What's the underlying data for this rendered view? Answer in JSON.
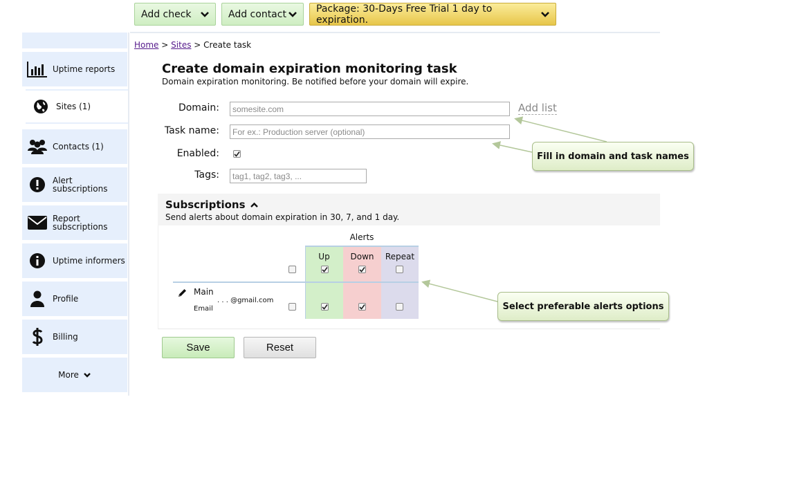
{
  "topbar": {
    "add_check": "Add check",
    "add_contact": "Add contact",
    "package": "Package: 30-Days Free Trial 1 day to expiration."
  },
  "sidebar": {
    "items": [
      {
        "label": "Uptime reports",
        "icon": "bar-chart-icon"
      },
      {
        "label": "Sites (1)",
        "icon": "globe-icon"
      },
      {
        "label": "Contacts (1)",
        "icon": "users-icon"
      },
      {
        "label_line1": "Alert",
        "label_line2": "subscriptions",
        "icon": "exclamation-icon"
      },
      {
        "label_line1": "Report",
        "label_line2": "subscriptions",
        "icon": "envelope-icon"
      },
      {
        "label": "Uptime informers",
        "icon": "info-icon"
      },
      {
        "label": "Profile",
        "icon": "user-icon"
      },
      {
        "label": "Billing",
        "icon": "dollar-icon"
      },
      {
        "label": "More",
        "icon": "chevron-down-icon"
      }
    ]
  },
  "breadcrumb": {
    "home": "Home",
    "sep": ">",
    "sites": "Sites",
    "current": "Create task"
  },
  "page": {
    "title": "Create domain expiration monitoring task",
    "subtitle": "Domain expiration monitoring. Be notified before your domain will expire."
  },
  "form": {
    "domain_label": "Domain:",
    "domain_placeholder": "somesite.com",
    "add_list": "Add list",
    "task_label": "Task name:",
    "task_placeholder": "For ex.: Production server (optional)",
    "enabled_label": "Enabled:",
    "enabled": true,
    "tags_label": "Tags:",
    "tags_placeholder": "tag1, tag2, tag3, ..."
  },
  "subscriptions": {
    "title": "Subscriptions",
    "description": "Send alerts about domain expiration in 30, 7, and 1 day.",
    "alerts_header": "Alerts",
    "columns": [
      "Up",
      "Down",
      "Repeat"
    ],
    "header_checks": {
      "all": false,
      "up": true,
      "down": true,
      "repeat": false
    },
    "row": {
      "name": "Main",
      "type": "Email",
      "address": ". . . @gmail.com",
      "all": false,
      "up": true,
      "down": true,
      "repeat": false
    },
    "colors": {
      "up": "#d3efc9",
      "down": "#f6cfcf",
      "repeat": "#dcdbec"
    }
  },
  "callouts": {
    "names": "Fill in domain and task names",
    "alerts": "Select preferable alerts options"
  },
  "actions": {
    "save": "Save",
    "reset": "Reset"
  }
}
